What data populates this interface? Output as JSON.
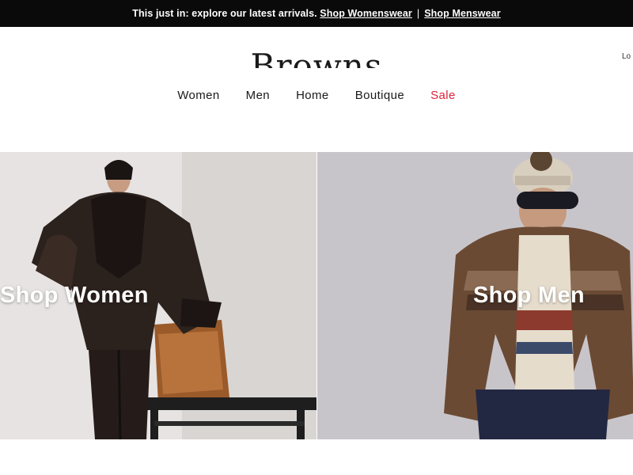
{
  "announcement": {
    "text": "This just in: explore our latest arrivals.",
    "links": [
      "Shop Womenswear",
      "Shop Menswear"
    ],
    "separator": "|"
  },
  "header": {
    "logo": "Browns",
    "login": "Lo"
  },
  "nav": {
    "items": [
      "Women",
      "Men",
      "Home",
      "Boutique",
      "Sale"
    ],
    "sale_color": "#e1233d"
  },
  "hero": {
    "panels": [
      {
        "label": "Shop Women"
      },
      {
        "label": "Shop Men"
      }
    ]
  },
  "colors": {
    "announcement_bg": "#0a0a0a",
    "text": "#1a1a1a",
    "accent_sale": "#e1233d"
  }
}
